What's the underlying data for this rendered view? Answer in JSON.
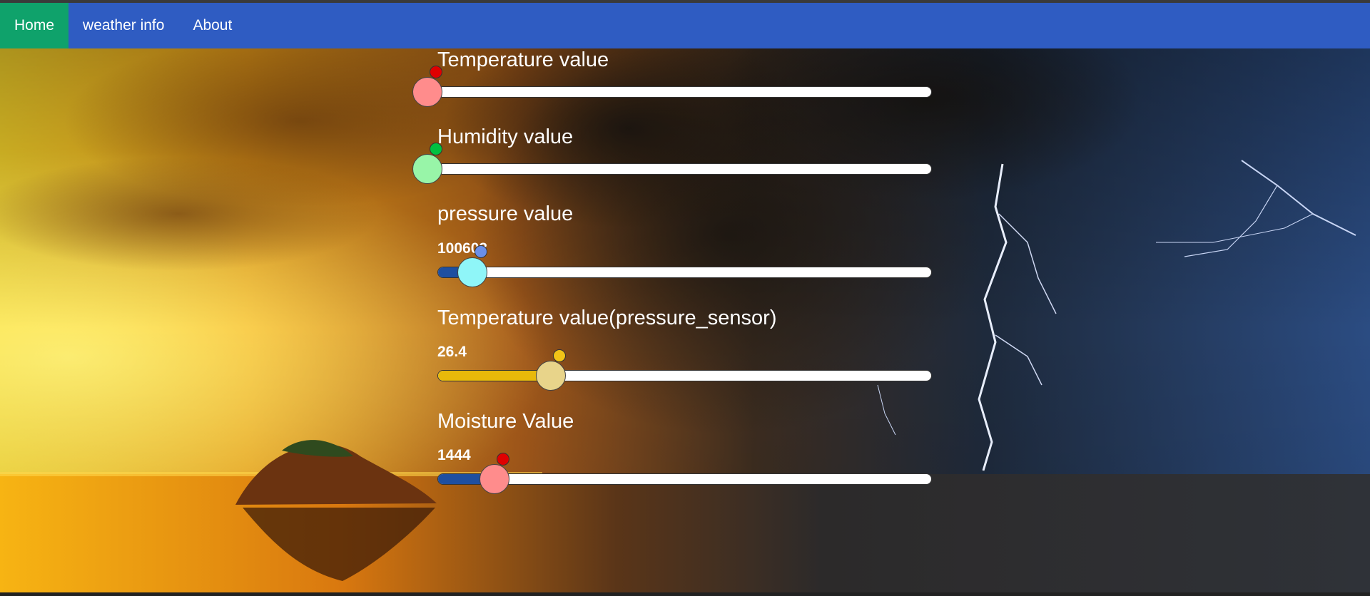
{
  "nav": {
    "items": [
      {
        "label": "Home",
        "active": true
      },
      {
        "label": "weather info",
        "active": false
      },
      {
        "label": "About",
        "active": false
      }
    ],
    "bar_color": "#2f5cc2",
    "active_color": "#0fa26b"
  },
  "sliders": [
    {
      "label": "Temperature value",
      "value_text": "",
      "level": 0.0,
      "thumb_color": "#ff8c8c",
      "dot_color": "#e00000",
      "fill_color": ""
    },
    {
      "label": "Humidity value",
      "value_text": "",
      "level": 0.0,
      "thumb_color": "#98f5a8",
      "dot_color": "#00c040",
      "fill_color": ""
    },
    {
      "label": "pressure value",
      "value_text": "100603",
      "level": 0.07,
      "thumb_color": "#8ff6f8",
      "dot_color": "#6a8fe8",
      "fill_color": "#1e4fa0"
    },
    {
      "label": "Temperature value(pressure_sensor)",
      "value_text": "26.4",
      "level": 0.23,
      "thumb_color": "#e8d48a",
      "dot_color": "#f2c417",
      "fill_color": "#e8b90a"
    },
    {
      "label": "Moisture Value",
      "value_text": "1444",
      "level": 0.115,
      "thumb_color": "#ff8c8c",
      "dot_color": "#e00000",
      "fill_color": "#1e4fa0"
    }
  ]
}
